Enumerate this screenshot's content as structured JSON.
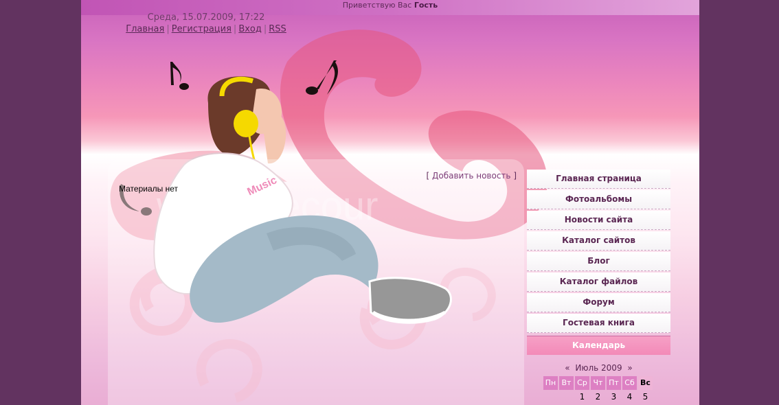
{
  "topbar": {
    "greeting": "Приветствую Вас",
    "user": "Гость"
  },
  "header": {
    "date": "Среда, 15.07.2009, 17:22",
    "links": [
      {
        "label": "Главная"
      },
      {
        "label": "Регистрация"
      },
      {
        "label": "Вход"
      },
      {
        "label": "RSS"
      }
    ],
    "separator": "|"
  },
  "content": {
    "no_materials": "Материалы нет",
    "add_news_open": "[",
    "add_news_label": "Добавить новость",
    "add_news_close": "]"
  },
  "menu": {
    "items": [
      {
        "label": "Главная страница"
      },
      {
        "label": "Фотоальбомы"
      },
      {
        "label": "Новости сайта"
      },
      {
        "label": "Каталог сайтов"
      },
      {
        "label": "Блог"
      },
      {
        "label": "Каталог файлов"
      },
      {
        "label": "Форум"
      },
      {
        "label": "Гостевая книга"
      }
    ]
  },
  "calendar": {
    "title": "Календарь",
    "prev": "«",
    "month": "Июль 2009",
    "next": "»",
    "weekdays": [
      "Пн",
      "Вт",
      "Ср",
      "Чт",
      "Пт",
      "Сб",
      "Вс"
    ],
    "first_week": [
      "",
      "",
      "1",
      "2",
      "3",
      "4",
      "5"
    ]
  },
  "colors": {
    "outer_background": "#623360",
    "accent_pink": "#f38ab8",
    "menu_text": "#5a2652"
  }
}
